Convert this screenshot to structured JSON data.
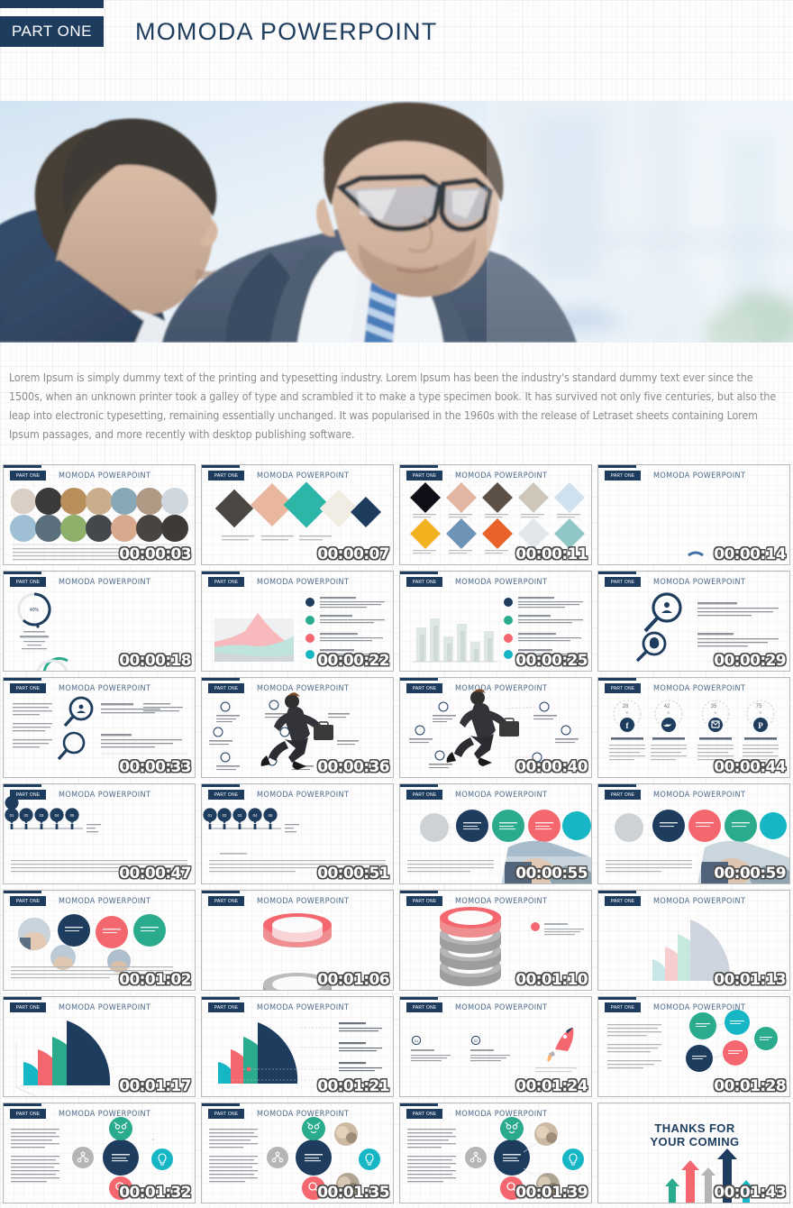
{
  "header": {
    "part_label": "PART ONE",
    "title": "MOMODA POWERPOINT",
    "accent_color": "#1d3c5e"
  },
  "hero": {
    "alt": "two businessmen in suits reviewing documents by a bright window"
  },
  "body": {
    "paragraph": "Lorem Ipsum is simply dummy text of the printing and typesetting industry. Lorem Ipsum has been the industry's standard dummy text ever since the 1500s, when an unknown printer took a galley of type and scrambled it to make a type specimen book. It has survived not only five centuries, but also the leap into electronic typesetting, remaining essentially unchanged. It was popularised in the 1960s with the release of Letraset sheets containing Lorem Ipsum passages, and more recently with desktop publishing software."
  },
  "palette": {
    "navy": "#1d3c5e",
    "teal": "#2aab8e",
    "coral": "#f4676f",
    "cyan": "#17b6c4",
    "grey": "#b5b5b5",
    "pale_pink": "#f7b9bb",
    "pale_teal": "#bfe3dd"
  },
  "thumbnails": [
    {
      "badge": "PART ONE",
      "title": "MOMODA POWERPOINT",
      "time": "00:00:03",
      "kind": "circle-photo-grid"
    },
    {
      "badge": "PART ONE",
      "title": "MOMODA POWERPOINT",
      "time": "00:00:07",
      "kind": "diamond-photo-row"
    },
    {
      "badge": "PART ONE",
      "title": "MOMODA POWERPOINT",
      "time": "00:00:11",
      "kind": "diamond-photo-grid"
    },
    {
      "badge": "PART ONE",
      "title": "MOMODA POWERPOINT",
      "time": "00:00:14",
      "kind": "blank"
    },
    {
      "badge": "PART ONE",
      "title": "MOMODA POWERPOINT",
      "time": "00:00:18",
      "kind": "donut-gauge"
    },
    {
      "badge": "PART ONE",
      "title": "MOMODA POWERPOINT",
      "time": "00:00:22",
      "kind": "area-chart-list"
    },
    {
      "badge": "PART ONE",
      "title": "MOMODA POWERPOINT",
      "time": "00:00:25",
      "kind": "bar-chart-list"
    },
    {
      "badge": "PART ONE",
      "title": "MOMODA POWERPOINT",
      "time": "00:00:29",
      "kind": "magnifier-pair"
    },
    {
      "badge": "PART ONE",
      "title": "MOMODA POWERPOINT",
      "time": "00:00:33",
      "kind": "magnifier-text"
    },
    {
      "badge": "PART ONE",
      "title": "MOMODA POWERPOINT",
      "time": "00:00:36",
      "kind": "running-man"
    },
    {
      "badge": "PART ONE",
      "title": "MOMODA POWERPOINT",
      "time": "00:00:40",
      "kind": "running-man"
    },
    {
      "badge": "PART ONE",
      "title": "MOMODA POWERPOINT",
      "time": "00:00:44",
      "kind": "social-stats"
    },
    {
      "badge": "PART ONE",
      "title": "MOMODA POWERPOINT",
      "time": "00:00:47",
      "kind": "timeline-pins"
    },
    {
      "badge": "PART ONE",
      "title": "MOMODA POWERPOINT",
      "time": "00:00:51",
      "kind": "timeline-pins"
    },
    {
      "badge": "PART ONE",
      "title": "MOMODA POWERPOINT",
      "time": "00:00:55",
      "kind": "circle-cluster-photo"
    },
    {
      "badge": "PART ONE",
      "title": "MOMODA POWERPOINT",
      "time": "00:00:59",
      "kind": "circle-cluster-photo"
    },
    {
      "badge": "PART ONE",
      "title": "MOMODA POWERPOINT",
      "time": "00:01:02",
      "kind": "circle-cluster-photo"
    },
    {
      "badge": "PART ONE",
      "title": "MOMODA POWERPOINT",
      "time": "00:01:06",
      "kind": "ring-3d-single"
    },
    {
      "badge": "PART ONE",
      "title": "MOMODA POWERPOINT",
      "time": "00:01:10",
      "kind": "ring-3d-stack"
    },
    {
      "badge": "PART ONE",
      "title": "MOMODA POWERPOINT",
      "time": "00:01:13",
      "kind": "fan-chart-pale"
    },
    {
      "badge": "PART ONE",
      "title": "MOMODA POWERPOINT",
      "time": "00:01:17",
      "kind": "fan-chart"
    },
    {
      "badge": "PART ONE",
      "title": "MOMODA POWERPOINT",
      "time": "00:01:21",
      "kind": "fan-chart-labels"
    },
    {
      "badge": "PART ONE",
      "title": "MOMODA POWERPOINT",
      "time": "00:01:24",
      "kind": "rocket-compare"
    },
    {
      "badge": "PART ONE",
      "title": "MOMODA POWERPOINT",
      "time": "00:01:28",
      "kind": "bubble-cluster"
    },
    {
      "badge": "PART ONE",
      "title": "MOMODA POWERPOINT",
      "time": "00:01:32",
      "kind": "icon-orbit"
    },
    {
      "badge": "PART ONE",
      "title": "MOMODA POWERPOINT",
      "time": "00:01:35",
      "kind": "icon-orbit-photo"
    },
    {
      "badge": "PART ONE",
      "title": "MOMODA POWERPOINT",
      "time": "00:01:39",
      "kind": "icon-orbit-photo"
    },
    {
      "badge": "PART ONE",
      "title": "MOMODA POWERPOINT",
      "time": "00:01:43",
      "kind": "thanks"
    }
  ],
  "final_slide": {
    "line1": "THANKS FOR",
    "line2": "YOUR COMING"
  }
}
